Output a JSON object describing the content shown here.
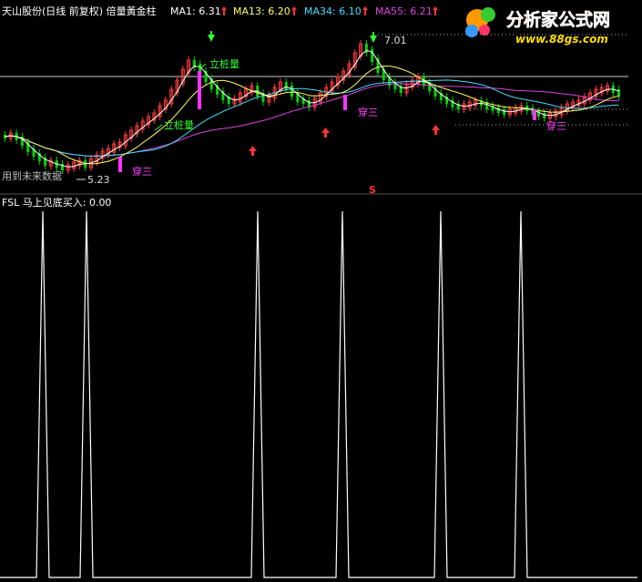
{
  "header": {
    "title": "天山股份(日线 前复权) 倍量黃金柱",
    "ma1_label": "MA1: 6.31",
    "ma13_label": "MA13: 6.20",
    "ma34_label": "MA34: 6.10",
    "ma55_label": "MA55: 6.21"
  },
  "watermark": {
    "name": "分析家公式网",
    "url": "www.88gs.com"
  },
  "colors": {
    "background": "#000000",
    "up": "#ff3b3b",
    "down": "#00d400",
    "ma1": "#ffffff",
    "ma13": "#ffff66",
    "ma34": "#44ddff",
    "ma55": "#dd44dd",
    "gold_bar": "#ff33ff",
    "up_arrow": "#ff3333",
    "down_arrow": "#33ff33",
    "label_green": "#33ff33",
    "label_magenta": "#ff44ff"
  },
  "annotations": {
    "high_price": "7.01",
    "low_price": "5.23",
    "future_data": "用到未来数据",
    "s_mark": "S",
    "lizhuang_1": "立桩量",
    "lizhuang_2": "立桩量",
    "chuansan_1": "穿三",
    "chuansan_2": "穿三",
    "chuansan_3": "穿三"
  },
  "indicator": {
    "label": "FSL  马上见底买入: 0.00"
  },
  "chart_data": [
    {
      "type": "candlestick",
      "title": "天山股份(日线 前复权) 倍量黃金柱",
      "moving_averages": [
        {
          "name": "MA1",
          "value": 6.31
        },
        {
          "name": "MA13",
          "value": 6.2
        },
        {
          "name": "MA34",
          "value": 6.1
        },
        {
          "name": "MA55",
          "value": 6.21
        }
      ],
      "annotated_high": 7.01,
      "annotated_low": 5.23,
      "grid": false
    },
    {
      "type": "line",
      "title": "FSL 马上见底买入",
      "current_value": 0.0,
      "grid": false
    }
  ]
}
